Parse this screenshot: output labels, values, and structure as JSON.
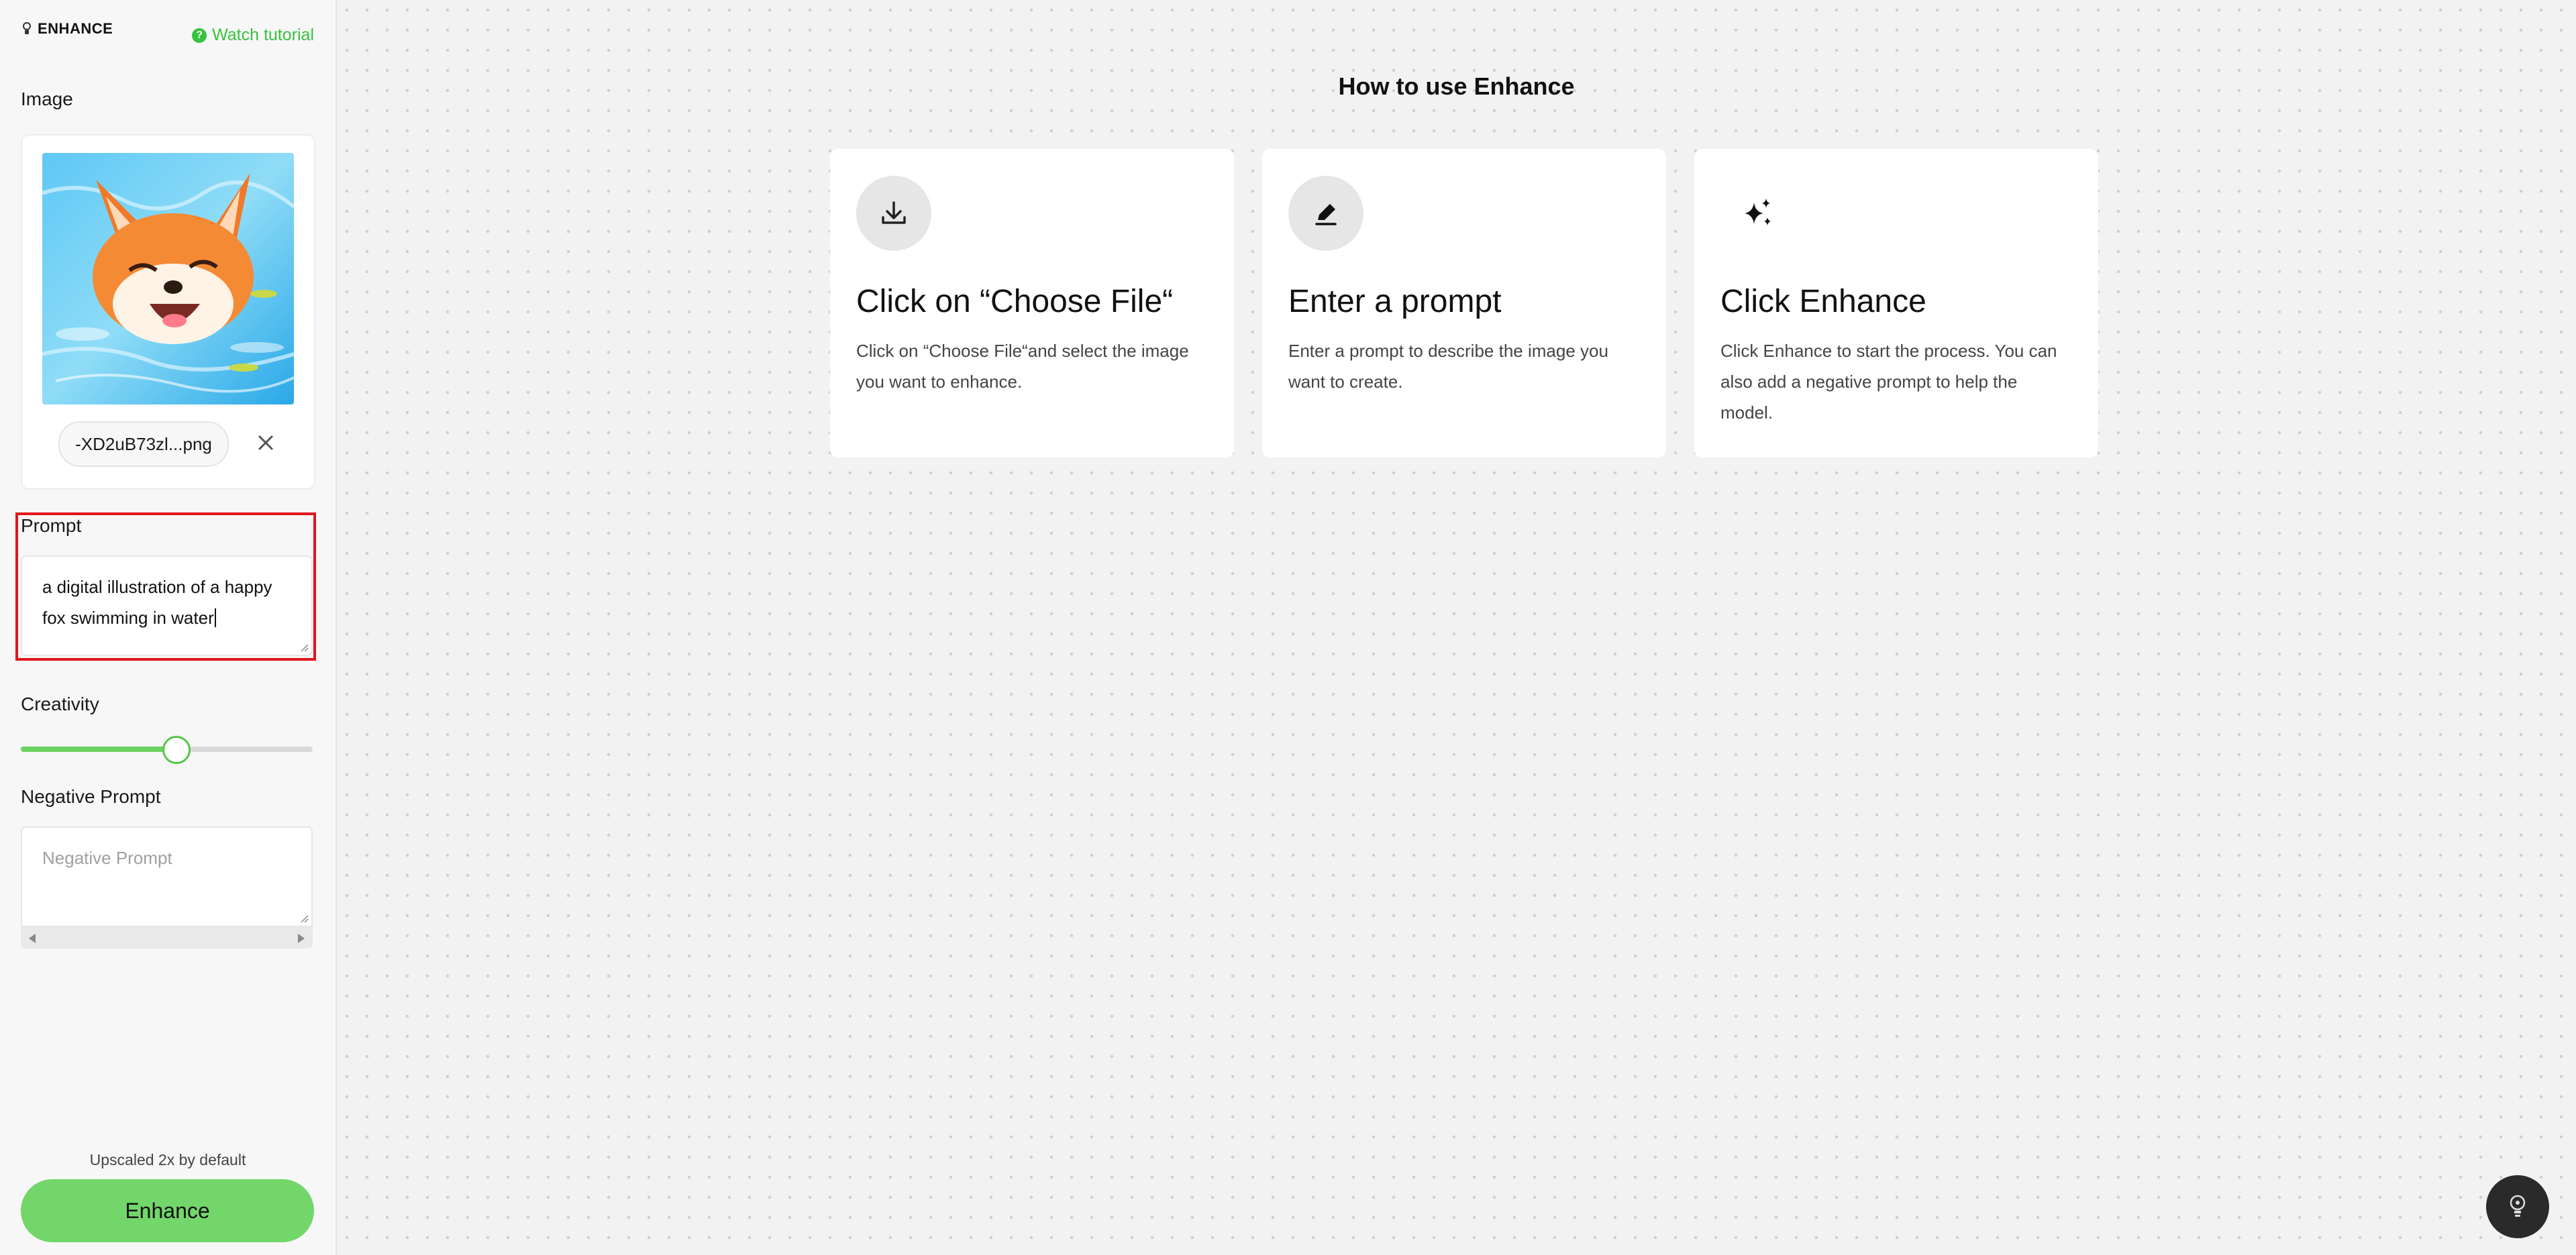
{
  "sidebar": {
    "brand": "ENHANCE",
    "tutorial_label": "Watch tutorial",
    "image_label": "Image",
    "file_name": "-XD2uB73zl...png",
    "prompt_label": "Prompt",
    "prompt_value": "a digital illustration of a happy fox swimming in water",
    "creativity_label": "Creativity",
    "creativity_value": 0.53,
    "negative_prompt_label": "Negative Prompt",
    "negative_prompt_placeholder": "Negative Prompt",
    "upscale_note": "Upscaled 2x by default",
    "enhance_button": "Enhance"
  },
  "main": {
    "title": "How to use Enhance",
    "steps": [
      {
        "icon": "download-icon",
        "title": "Click on “Choose File“",
        "description": "Click on “Choose File“and select the image you want to enhance."
      },
      {
        "icon": "pencil-icon",
        "title": "Enter a prompt",
        "description": "Enter a prompt to describe the image you want to create."
      },
      {
        "icon": "sparkles-icon",
        "title": "Click Enhance",
        "description": "Click Enhance to start the process. You can also add a negative prompt to help the model."
      }
    ]
  },
  "colors": {
    "accent_green": "#72d66a",
    "link_green": "#36c23e",
    "highlight_red": "#e0161c"
  }
}
